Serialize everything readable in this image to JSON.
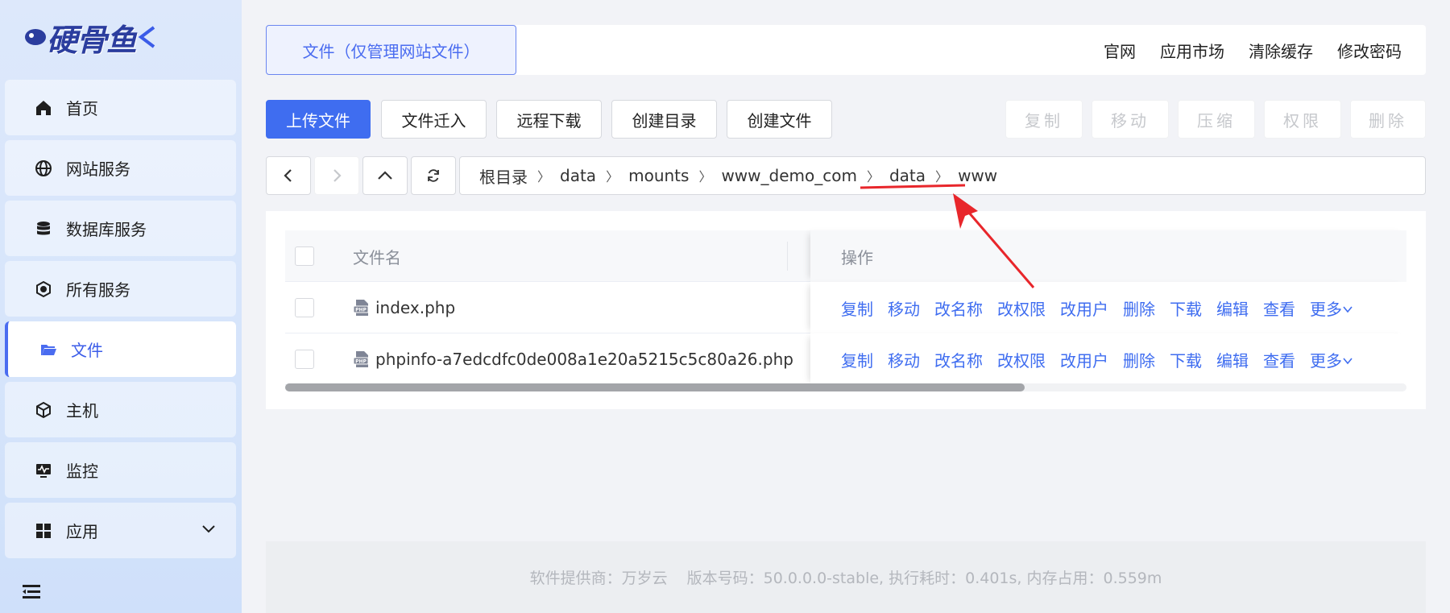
{
  "logo": {
    "text": "硬骨鱼"
  },
  "sidebar": {
    "items": [
      {
        "label": "首页",
        "icon": "home-icon"
      },
      {
        "label": "网站服务",
        "icon": "globe-icon"
      },
      {
        "label": "数据库服务",
        "icon": "database-icon"
      },
      {
        "label": "所有服务",
        "icon": "services-icon"
      },
      {
        "label": "文件",
        "icon": "folder-icon",
        "active": true
      },
      {
        "label": "主机",
        "icon": "host-icon"
      },
      {
        "label": "监控",
        "icon": "monitor-icon"
      },
      {
        "label": "应用",
        "icon": "apps-grid-icon",
        "expandable": true
      }
    ],
    "collapse_icon": "menu-collapse-icon"
  },
  "header": {
    "tab_label": "文件（仅管理网站文件）",
    "links": [
      "官网",
      "应用市场",
      "清除缓存",
      "修改密码"
    ]
  },
  "toolbar": {
    "upload": "上传文件",
    "import": "文件迁入",
    "remote_download": "远程下载",
    "create_dir": "创建目录",
    "create_file": "创建文件",
    "copy": "复制",
    "move": "移动",
    "compress": "压缩",
    "permission": "权限",
    "delete": "删除"
  },
  "path": {
    "crumbs": [
      "根目录",
      "data",
      "mounts",
      "www_demo_com",
      "data",
      "www"
    ]
  },
  "table": {
    "headers": {
      "name": "文件名",
      "ops": "操作"
    },
    "rows": [
      {
        "name": "index.php"
      },
      {
        "name": "phpinfo-a7edcdfc0de008a1e20a5215c5c80a26.php"
      }
    ],
    "ops": [
      "复制",
      "移动",
      "改名称",
      "改权限",
      "改用户",
      "删除",
      "下载",
      "编辑",
      "查看",
      "更多"
    ]
  },
  "footer": {
    "provider": "软件提供商：万岁云",
    "version": "版本号码：50.0.0.0-stable, 执行耗时：0.401s, 内存占用：0.559m"
  },
  "colors": {
    "accent": "#3f6df0",
    "annotation": "#e8262b"
  }
}
